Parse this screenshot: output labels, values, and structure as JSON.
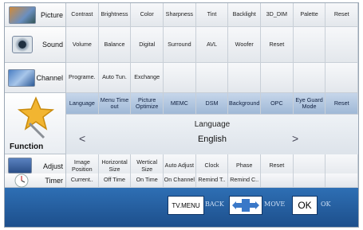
{
  "rows": {
    "picture": {
      "label": "Picture",
      "items": [
        "Contrast",
        "Brightness",
        "Color",
        "Sharpness",
        "Tint",
        "Backlight",
        "3D_DIM",
        "Palette",
        "Reset"
      ]
    },
    "sound": {
      "label": "Sound",
      "items": [
        "Volume",
        "Balance",
        "Digital",
        "Surround",
        "AVL",
        "Woofer",
        "Reset",
        "",
        ""
      ]
    },
    "channel": {
      "label": "Channel",
      "items": [
        "Programe.",
        "Auto Tun.",
        "Exchange",
        "",
        "",
        "",
        "",
        "",
        ""
      ]
    },
    "function": {
      "label": "Function",
      "items": [
        "Language",
        "Menu Time out",
        "Picture Optimize",
        "MEMC",
        "DSM",
        "Background",
        "OPC",
        "Eye Guard Mode",
        "Reset"
      ],
      "selected_title": "Language",
      "selected_value": "English",
      "left_arrow": "<",
      "right_arrow": ">"
    },
    "adjust": {
      "label": "Adjust",
      "items": [
        "Image Position",
        "Horizontal Size",
        "Wertical Size",
        "Auto Adjust",
        "Clock",
        "Phase",
        "Reset",
        "",
        ""
      ]
    },
    "timer": {
      "label": "Timer",
      "items": [
        "Current..",
        "Off Time",
        "On Time",
        "On Channel",
        "Remind T..",
        "Remind C..",
        "",
        "",
        ""
      ]
    }
  },
  "footer": {
    "menu_btn": "TV.MENU",
    "back": "BACK",
    "move": "MOVE",
    "ok_btn": "OK",
    "ok": "OK"
  },
  "colors": {
    "accent": "#2e6fb4",
    "selected": "#b2c7e0"
  },
  "icons": {
    "picture": "tv-screen-icon",
    "sound": "speaker-icon",
    "channel": "channel-icon",
    "function": "star-wand-icon",
    "adjust": "adjust-icon",
    "timer": "clock-icon",
    "move": "cross-arrows-icon"
  }
}
